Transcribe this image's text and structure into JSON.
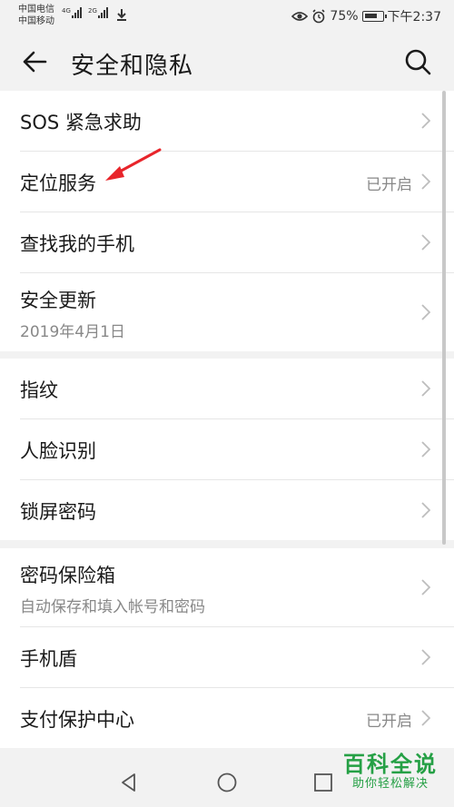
{
  "status_bar": {
    "carrier_1": "中国电信",
    "carrier_2": "中国移动",
    "net_1": "4G",
    "net_2": "2G",
    "battery": "75%",
    "time": "下午2:37",
    "icons": [
      "signal-icon",
      "download-icon",
      "eye-comfort-icon",
      "alarm-icon",
      "battery-icon"
    ]
  },
  "header": {
    "title": "安全和隐私",
    "back_icon": "back-arrow-icon",
    "search_icon": "search-icon"
  },
  "groups": [
    {
      "items": [
        {
          "label": "SOS 紧急求助",
          "value": "",
          "sub": ""
        },
        {
          "label": "定位服务",
          "value": "已开启",
          "sub": ""
        },
        {
          "label": "查找我的手机",
          "value": "",
          "sub": ""
        },
        {
          "label": "安全更新",
          "value": "",
          "sub": "2019年4月1日"
        }
      ]
    },
    {
      "items": [
        {
          "label": "指纹",
          "value": "",
          "sub": ""
        },
        {
          "label": "人脸识别",
          "value": "",
          "sub": ""
        },
        {
          "label": "锁屏密码",
          "value": "",
          "sub": ""
        }
      ]
    },
    {
      "items": [
        {
          "label": "密码保险箱",
          "value": "",
          "sub": "自动保存和填入帐号和密码"
        },
        {
          "label": "手机盾",
          "value": "",
          "sub": ""
        },
        {
          "label": "支付保护中心",
          "value": "已开启",
          "sub": ""
        }
      ]
    }
  ],
  "watermark": {
    "main": "百科全说",
    "sub": "助你轻松解决"
  },
  "colors": {
    "background": "#f2f2f2",
    "card": "#ffffff",
    "annotation_arrow": "#e8252b",
    "watermark": "#25a045"
  }
}
